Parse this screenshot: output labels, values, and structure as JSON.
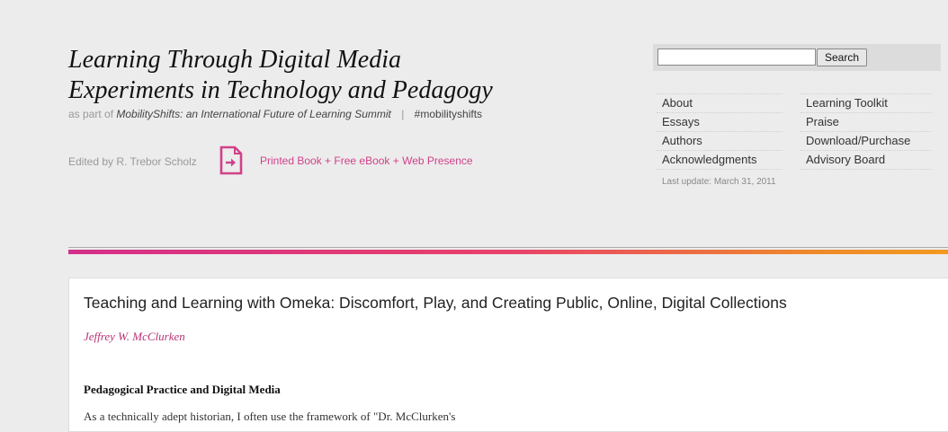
{
  "header": {
    "title_line1": "Learning Through Digital Media",
    "title_line2": "Experiments in Technology and Pedagogy",
    "part_of_prefix": "as part of",
    "summit": "MobilityShifts: an International Future of Learning Summit",
    "separator": "|",
    "hashtag": "#mobilityshifts",
    "edited_by": "Edited by R. Trebor Scholz",
    "book_link": "Printed Book + Free eBook + Web Presence",
    "book_icon": "book-arrow-icon",
    "accent_color": "#d1418a"
  },
  "search": {
    "placeholder": "",
    "value": "",
    "button_label": "Search"
  },
  "nav": {
    "left": [
      "About",
      "Essays",
      "Authors",
      "Acknowledgments"
    ],
    "right": [
      "Learning Toolkit",
      "Praise",
      "Download/Purchase",
      "Advisory Board"
    ]
  },
  "last_update": "Last update: March 31, 2011",
  "article": {
    "title": "Teaching and Learning with Omeka: Discomfort, Play, and Creating Public, Online, Digital Collections",
    "author": "Jeffrey W. McClurken",
    "section_heading": "Pedagogical Practice and Digital Media",
    "body_start": "As a technically adept historian, I often use the framework of \"Dr. McClurken's"
  }
}
